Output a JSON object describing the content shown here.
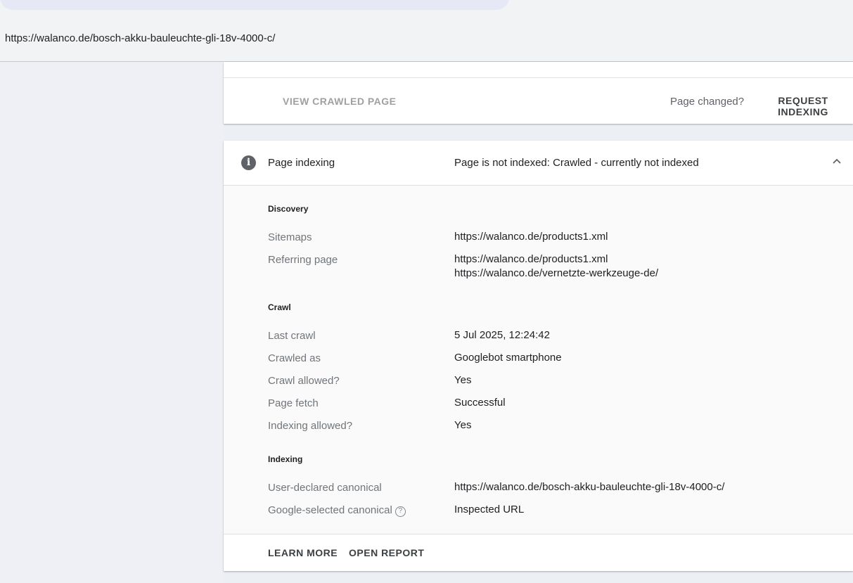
{
  "header": {
    "url": "https://walanco.de/bosch-akku-bauleuchte-gli-18v-4000-c/"
  },
  "crawl_card": {
    "view_crawled_label": "VIEW CRAWLED PAGE",
    "page_changed_label": "Page changed?",
    "request_indexing_label": "REQUEST INDEXING"
  },
  "indexing_card": {
    "icon": "info-icon",
    "title": "Page indexing",
    "status": "Page is not indexed: Crawled - currently not indexed",
    "discovery": {
      "title": "Discovery",
      "sitemaps_label": "Sitemaps",
      "sitemaps_value": "https://walanco.de/products1.xml",
      "referring_label": "Referring page",
      "referring_values": [
        "https://walanco.de/products1.xml",
        "https://walanco.de/vernetzte-werkzeuge-de/"
      ]
    },
    "crawl": {
      "title": "Crawl",
      "rows": [
        {
          "label": "Last crawl",
          "value": "5 Jul 2025, 12:24:42"
        },
        {
          "label": "Crawled as",
          "value": "Googlebot smartphone"
        },
        {
          "label": "Crawl allowed?",
          "value": "Yes"
        },
        {
          "label": "Page fetch",
          "value": "Successful"
        },
        {
          "label": "Indexing allowed?",
          "value": "Yes"
        }
      ]
    },
    "indexing": {
      "title": "Indexing",
      "rows": [
        {
          "label": "User-declared canonical",
          "value": "https://walanco.de/bosch-akku-bauleuchte-gli-18v-4000-c/"
        },
        {
          "label": "Google-selected canonical",
          "value": "Inspected URL"
        }
      ]
    },
    "footer": {
      "learn_more_label": "LEARN MORE",
      "open_report_label": "OPEN REPORT"
    }
  }
}
